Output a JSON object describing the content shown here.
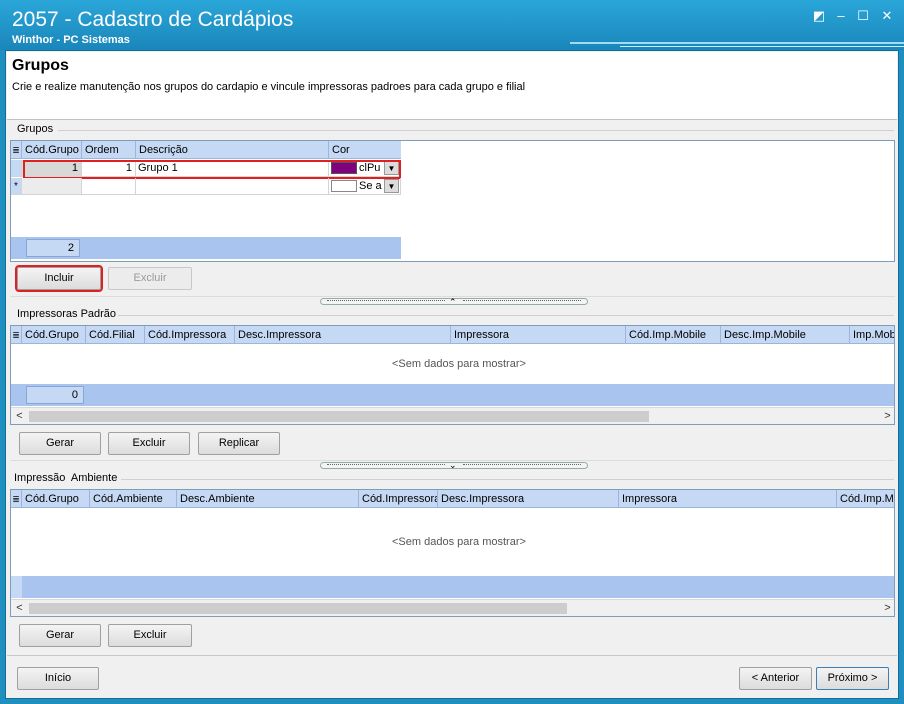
{
  "window": {
    "title": "2057 - Cadastro de Cardápios",
    "subtitle": "Winthor - PC Sistemas",
    "buttons": [
      "◩",
      "–",
      "☐",
      "✕"
    ]
  },
  "header": {
    "title": "Grupos",
    "description": "Crie e realize manutenção nos grupos do cardapio e vincule impressoras padroes para cada grupo e filial"
  },
  "grupos": {
    "section_label": "Grupos",
    "columns": [
      "Cód.Grupo",
      "Ordem",
      "Descrição",
      "Cor"
    ],
    "rows": [
      {
        "cod_grupo": "1",
        "ordem": "1",
        "descricao": "Grupo 1",
        "cor_text": "clPu",
        "cor_color": "#800080"
      }
    ],
    "new_row_marker": "*",
    "new_row_cor_text": "Se a",
    "footer_count": "2",
    "buttons": {
      "incluir": "Incluir",
      "excluir": "Excluir"
    }
  },
  "impressoras": {
    "section_label": "Impressoras Padrão",
    "columns": [
      "Cód.Grupo",
      "Cód.Filial",
      "Cód.Impressora",
      "Desc.Impressora",
      "Impressora",
      "Cód.Imp.Mobile",
      "Desc.Imp.Mobile",
      "Imp.Mob"
    ],
    "empty_message": "<Sem dados para mostrar>",
    "footer_count": "0",
    "buttons": {
      "gerar": "Gerar",
      "excluir": "Excluir",
      "replicar": "Replicar"
    }
  },
  "ambiente": {
    "section_label": "Impressão  Ambiente",
    "columns": [
      "Cód.Grupo",
      "Cód.Ambiente",
      "Desc.Ambiente",
      "Cód.Impressora",
      "Desc.Impressora",
      "Impressora",
      "Cód.Imp.Me"
    ],
    "empty_message": "<Sem dados para mostrar>",
    "buttons": {
      "gerar": "Gerar",
      "excluir": "Excluir"
    }
  },
  "nav": {
    "inicio": "Início",
    "anterior": "< Anterior",
    "proximo": "Próximo >"
  },
  "icons": {
    "grid_menu": "≣",
    "dropdown": "▼",
    "scroll_left": "<",
    "scroll_right": ">",
    "split_up": "⌃",
    "split_down": "⌄"
  }
}
